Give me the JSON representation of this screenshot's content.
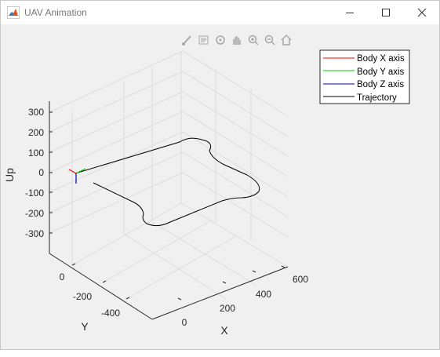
{
  "window": {
    "title": "UAV Animation",
    "icon": "matlab-icon",
    "controls": [
      "minimize-icon",
      "maximize-icon",
      "close-icon"
    ]
  },
  "toolbar": {
    "icons": [
      "brush-icon",
      "data-tips-icon",
      "rotate-3d-icon",
      "pan-icon",
      "zoom-in-icon",
      "zoom-out-icon",
      "home-icon"
    ]
  },
  "chart_data": {
    "type": "line3d",
    "zlabel": "Up",
    "xlabel": "X",
    "ylabel": "Y",
    "zticks": [
      "300",
      "200",
      "100",
      "0",
      "-100",
      "-200",
      "-300"
    ],
    "xticks": [
      "0",
      "200",
      "400",
      "600"
    ],
    "yticks": [
      "0",
      "-200",
      "-400"
    ],
    "legend": {
      "location": "top-right",
      "entries": [
        {
          "label": "Body X axis",
          "color": "#ff0000"
        },
        {
          "label": "Body Y axis",
          "color": "#00cc00"
        },
        {
          "label": "Body Z axis",
          "color": "#0000aa"
        },
        {
          "label": "Trajectory",
          "color": "#000000"
        }
      ]
    },
    "grid": "on",
    "colors": {
      "trajectory": "#000000",
      "axes": "#262626",
      "grid": "#dcdcdc"
    }
  }
}
